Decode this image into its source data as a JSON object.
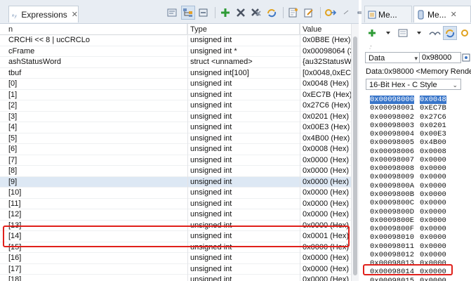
{
  "expressions_view": {
    "tab_label": "Expressions",
    "columns": [
      "n",
      "Type",
      "Value"
    ],
    "rows": [
      {
        "name": "CRCHi << 8 | ucCRCLo",
        "type": "unsigned int",
        "value": "0x0B8E (Hex)"
      },
      {
        "name": "cFrame",
        "type": "unsigned int *",
        "value": "0x00098064 (3"
      },
      {
        "name": "ashStatusWord",
        "type": "struct <unnamed>",
        "value": "{au32StatusWc"
      },
      {
        "name": "tbuf",
        "type": "unsigned int[100]",
        "value": "[0x0048,0xEC7"
      },
      {
        "name": "[0]",
        "type": "unsigned int",
        "value": "0x0048 (Hex)"
      },
      {
        "name": "[1]",
        "type": "unsigned int",
        "value": "0xEC7B (Hex)"
      },
      {
        "name": "[2]",
        "type": "unsigned int",
        "value": "0x27C6 (Hex)"
      },
      {
        "name": "[3]",
        "type": "unsigned int",
        "value": "0x0201 (Hex)"
      },
      {
        "name": "[4]",
        "type": "unsigned int",
        "value": "0x00E3 (Hex)"
      },
      {
        "name": "[5]",
        "type": "unsigned int",
        "value": "0x4B00 (Hex)"
      },
      {
        "name": "[6]",
        "type": "unsigned int",
        "value": "0x0008 (Hex)"
      },
      {
        "name": "[7]",
        "type": "unsigned int",
        "value": "0x0000 (Hex)"
      },
      {
        "name": "[8]",
        "type": "unsigned int",
        "value": "0x0000 (Hex)"
      },
      {
        "name": "[9]",
        "type": "unsigned int",
        "value": "0x0000 (Hex)"
      },
      {
        "name": "[10]",
        "type": "unsigned int",
        "value": "0x0000 (Hex)"
      },
      {
        "name": "[11]",
        "type": "unsigned int",
        "value": "0x0000 (Hex)"
      },
      {
        "name": "[12]",
        "type": "unsigned int",
        "value": "0x0000 (Hex)"
      },
      {
        "name": "[13]",
        "type": "unsigned int",
        "value": "0x0000 (Hex)"
      },
      {
        "name": "[14]",
        "type": "unsigned int",
        "value": "0x0001 (Hex)"
      },
      {
        "name": "[15]",
        "type": "unsigned int",
        "value": "0x0000 (Hex)"
      },
      {
        "name": "[16]",
        "type": "unsigned int",
        "value": "0x0000 (Hex)"
      },
      {
        "name": "[17]",
        "type": "unsigned int",
        "value": "0x0000 (Hex)"
      },
      {
        "name": "[18]",
        "type": "unsigned int",
        "value": "0x0000 (Hex)"
      }
    ],
    "selected_row": 13,
    "annotated_row": 18
  },
  "memory_view": {
    "tab_inactive_label": "Me...",
    "tab_active_label": "Me...",
    "dropdown_value": "Data",
    "address_input": "0x98000",
    "title": "Data:0x98000 <Memory Rende...",
    "format": "16-Bit Hex - C Style",
    "rows": [
      {
        "addr": "0x00098000",
        "val": "0x0048"
      },
      {
        "addr": "0x00098001",
        "val": "0xEC7B"
      },
      {
        "addr": "0x00098002",
        "val": "0x27C6"
      },
      {
        "addr": "0x00098003",
        "val": "0x0201"
      },
      {
        "addr": "0x00098004",
        "val": "0x00E3"
      },
      {
        "addr": "0x00098005",
        "val": "0x4B00"
      },
      {
        "addr": "0x00098006",
        "val": "0x0008"
      },
      {
        "addr": "0x00098007",
        "val": "0x0000"
      },
      {
        "addr": "0x00098008",
        "val": "0x0000"
      },
      {
        "addr": "0x00098009",
        "val": "0x0000"
      },
      {
        "addr": "0x0009800A",
        "val": "0x0000"
      },
      {
        "addr": "0x0009800B",
        "val": "0x0000"
      },
      {
        "addr": "0x0009800C",
        "val": "0x0000"
      },
      {
        "addr": "0x0009800D",
        "val": "0x0000"
      },
      {
        "addr": "0x0009800E",
        "val": "0x0000"
      },
      {
        "addr": "0x0009800F",
        "val": "0x0000"
      },
      {
        "addr": "0x00098010",
        "val": "0x0000"
      },
      {
        "addr": "0x00098011",
        "val": "0x0000"
      },
      {
        "addr": "0x00098012",
        "val": "0x0000"
      },
      {
        "addr": "0x00098013",
        "val": "0x0000"
      },
      {
        "addr": "0x00098014",
        "val": "0x0000"
      },
      {
        "addr": "0x00098015",
        "val": "0x0000"
      }
    ],
    "highlight_row": 0,
    "annotated_row": 20
  },
  "colors": {
    "annotation_red": "#e0201b",
    "selection_blue": "#3875c9",
    "row_selected": "#dde8f4"
  }
}
